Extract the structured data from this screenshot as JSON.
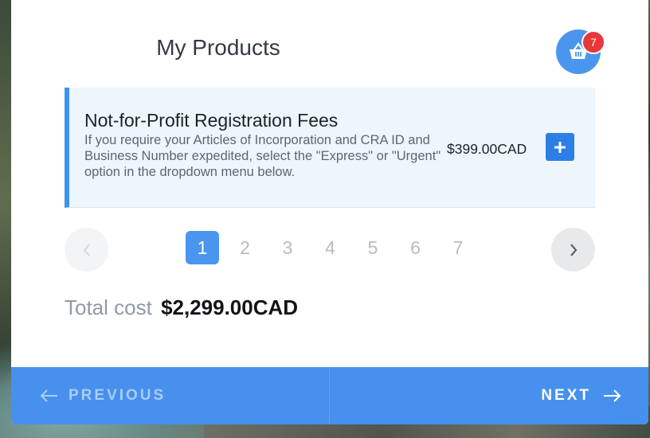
{
  "modal": {
    "title": "My Products",
    "cart": {
      "icon": "basket-icon",
      "badge_count": "7"
    }
  },
  "product": {
    "name": "Not-for-Profit Registration Fees",
    "description": "If you require your Articles of Incorporation and CRA ID and Business Number expedited, select the \"Express\" or \"Urgent\" option in the dropdown menu below.",
    "price": "$399.00CAD",
    "add_label": "+"
  },
  "pagination": {
    "pages": [
      "1",
      "2",
      "3",
      "4",
      "5",
      "6",
      "7"
    ],
    "current": "1"
  },
  "total": {
    "label": "Total cost",
    "amount": "$2,299.00CAD"
  },
  "footer": {
    "previous_label": "PREVIOUS",
    "next_label": "NEXT"
  },
  "colors": {
    "accent": "#4a96ef",
    "badge": "#e8373a",
    "card_bg": "#eef6fd"
  }
}
